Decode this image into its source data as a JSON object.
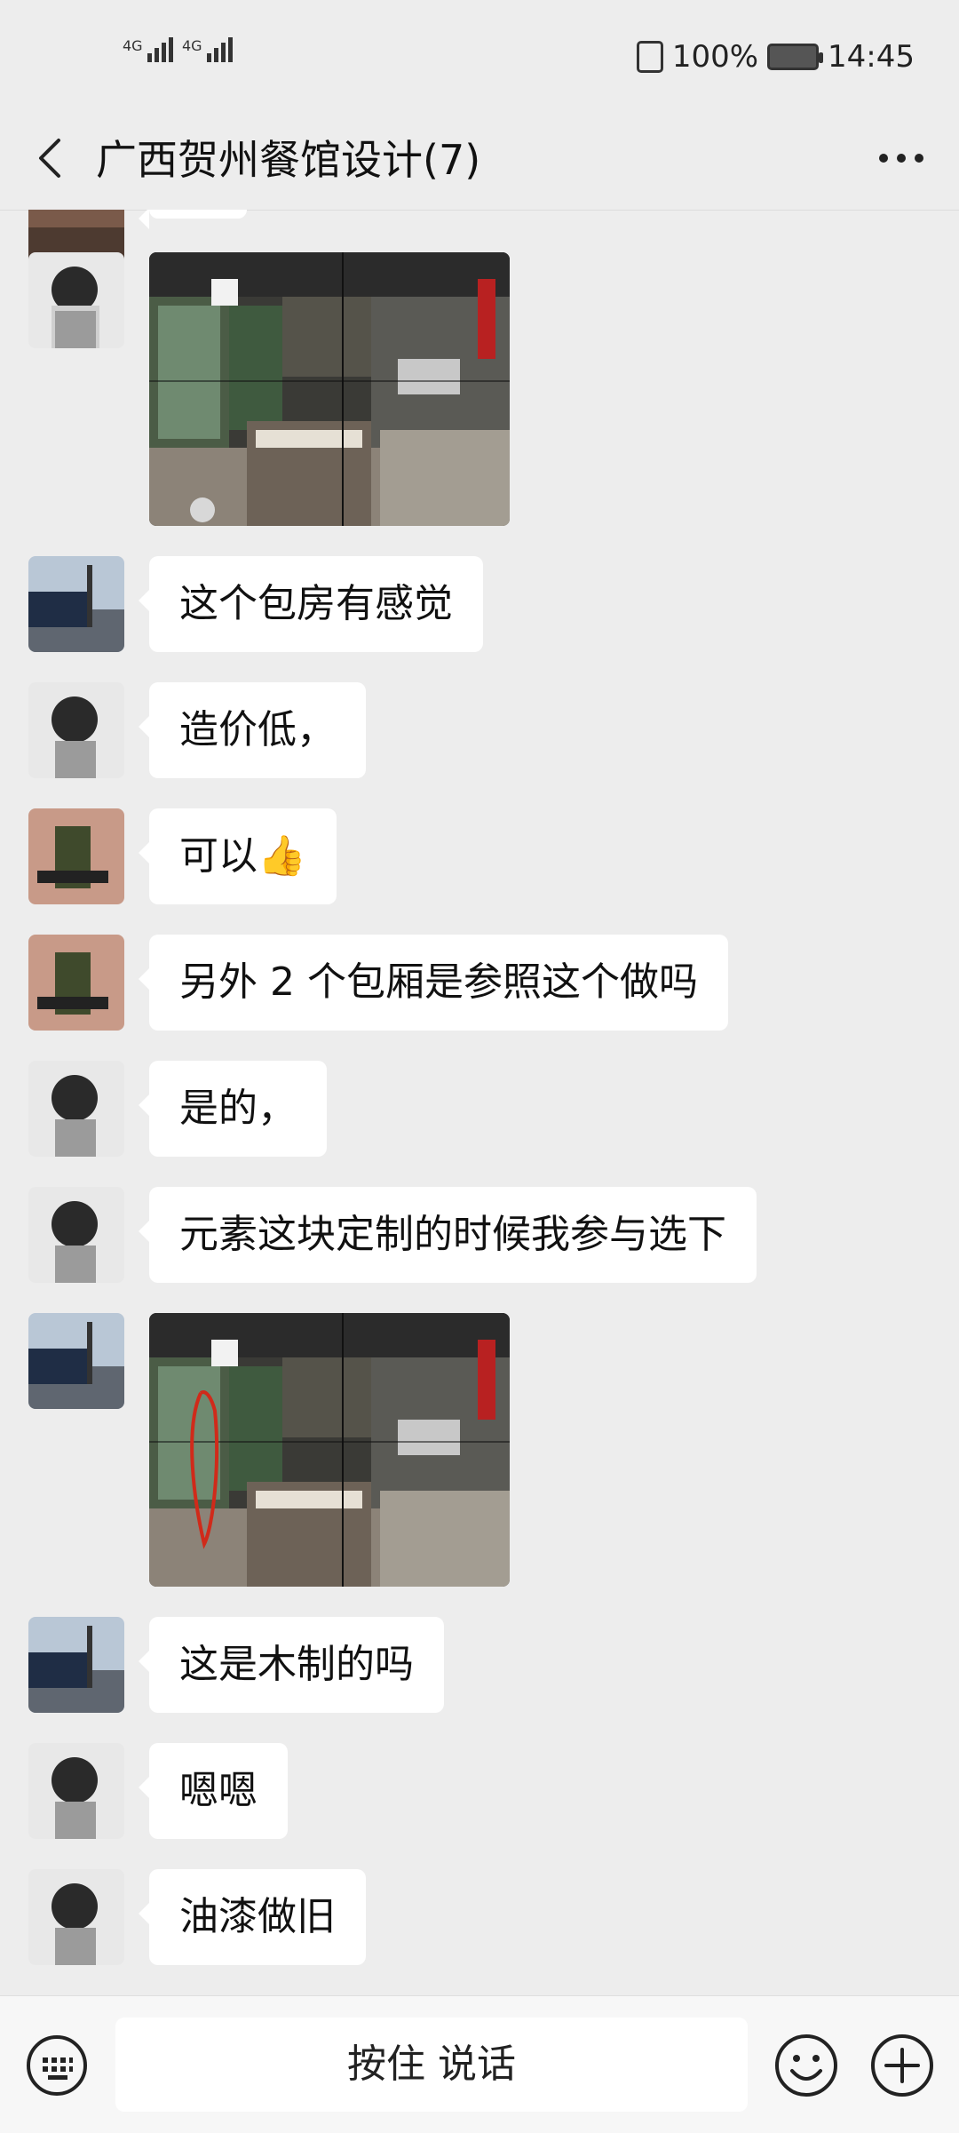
{
  "status_bar": {
    "network_1": "4G",
    "network_2": "4G",
    "battery": "100%",
    "time": "14:45"
  },
  "header": {
    "title": "广西贺州餐馆设计(7)"
  },
  "messages": [
    {
      "type": "image",
      "avatar": "avatar-b"
    },
    {
      "type": "text",
      "avatar": "avatar-c",
      "text": "这个包房有感觉"
    },
    {
      "type": "text",
      "avatar": "avatar-b",
      "text": "造价低，"
    },
    {
      "type": "text",
      "avatar": "avatar-d",
      "text": "可以",
      "emoji": "👍"
    },
    {
      "type": "text",
      "avatar": "avatar-d",
      "text": "另外 2 个包厢是参照这个做吗"
    },
    {
      "type": "text",
      "avatar": "avatar-b",
      "text": "是的，"
    },
    {
      "type": "text",
      "avatar": "avatar-b",
      "text": "元素这块定制的时候我参与选下"
    },
    {
      "type": "image",
      "avatar": "avatar-c",
      "annotated": true
    },
    {
      "type": "text",
      "avatar": "avatar-c",
      "text": "这是木制的吗"
    },
    {
      "type": "text",
      "avatar": "avatar-b",
      "text": "嗯嗯"
    },
    {
      "type": "text",
      "avatar": "avatar-b",
      "text": "油漆做旧"
    }
  ],
  "input_bar": {
    "voice_label": "按住 说话"
  },
  "icons": {
    "back": "chevron-left-icon",
    "more": "more-dots-icon",
    "keyboard": "keyboard-icon",
    "emoji": "smiley-icon",
    "plus": "plus-icon"
  }
}
